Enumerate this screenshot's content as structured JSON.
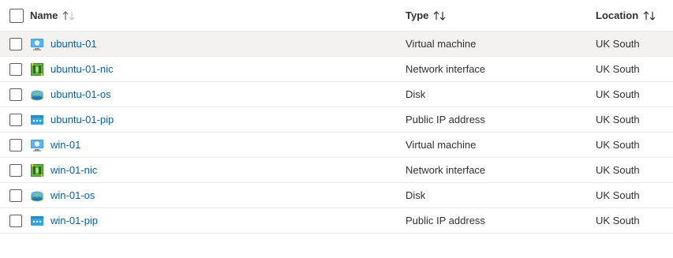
{
  "table": {
    "columns": [
      {
        "label": "Name",
        "sort": "asc-light"
      },
      {
        "label": "Type",
        "sort": "both"
      },
      {
        "label": "Location",
        "sort": "both"
      }
    ],
    "rows": [
      {
        "name": "ubuntu-01",
        "type": "Virtual machine",
        "location": "UK South",
        "icon": "virtual-machine-icon"
      },
      {
        "name": "ubuntu-01-nic",
        "type": "Network interface",
        "location": "UK South",
        "icon": "network-interface-icon"
      },
      {
        "name": "ubuntu-01-os",
        "type": "Disk",
        "location": "UK South",
        "icon": "disk-icon"
      },
      {
        "name": "ubuntu-01-pip",
        "type": "Public IP address",
        "location": "UK South",
        "icon": "public-ip-icon"
      },
      {
        "name": "win-01",
        "type": "Virtual machine",
        "location": "UK South",
        "icon": "virtual-machine-icon"
      },
      {
        "name": "win-01-nic",
        "type": "Network interface",
        "location": "UK South",
        "icon": "network-interface-icon"
      },
      {
        "name": "win-01-os",
        "type": "Disk",
        "location": "UK South",
        "icon": "disk-icon"
      },
      {
        "name": "win-01-pip",
        "type": "Public IP address",
        "location": "UK South",
        "icon": "public-ip-icon"
      }
    ]
  },
  "colors": {
    "link": "#0064b4",
    "hover_row": "#f3f2f1",
    "divider": "#edebe9"
  }
}
